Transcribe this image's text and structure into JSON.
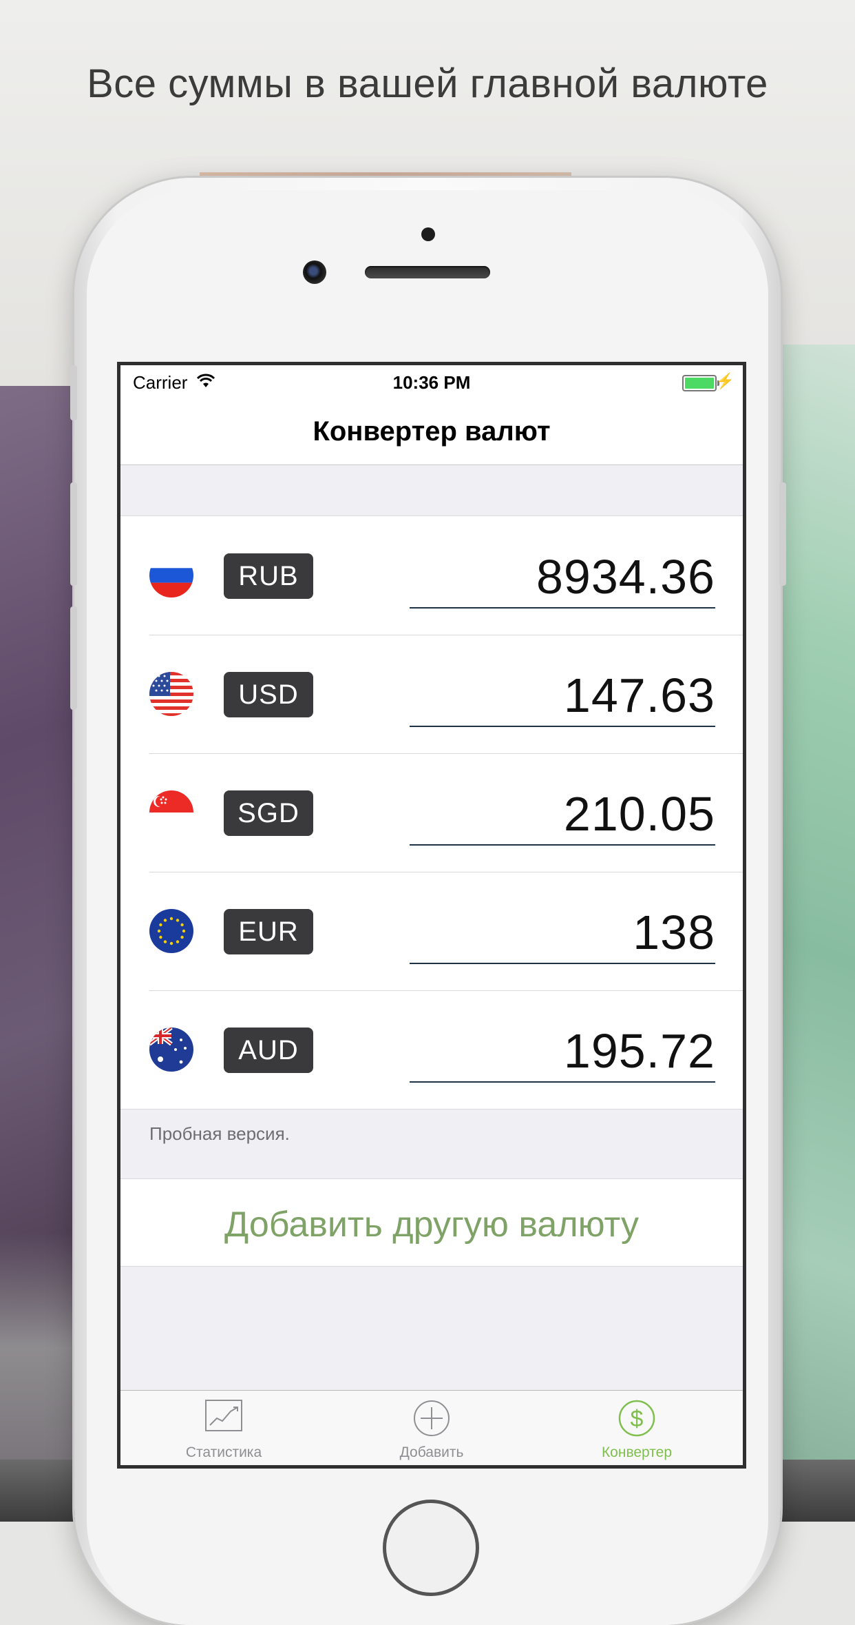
{
  "headline": "Все суммы в вашей главной валюте",
  "status_bar": {
    "carrier": "Carrier",
    "time": "10:36 PM"
  },
  "nav": {
    "title": "Конвертер валют"
  },
  "currencies": [
    {
      "code": "RUB",
      "amount": "8934.36",
      "flag": "russia-flag-icon"
    },
    {
      "code": "USD",
      "amount": "147.63",
      "flag": "usa-flag-icon"
    },
    {
      "code": "SGD",
      "amount": "210.05",
      "flag": "singapore-flag-icon"
    },
    {
      "code": "EUR",
      "amount": "138",
      "flag": "eu-flag-icon"
    },
    {
      "code": "AUD",
      "amount": "195.72",
      "flag": "australia-flag-icon"
    }
  ],
  "trial_note": "Пробная версия.",
  "add_currency_label": "Добавить другую валюту",
  "tabs": [
    {
      "label": "Статистика",
      "icon": "chart-icon",
      "active": false
    },
    {
      "label": "Добавить",
      "icon": "plus-circle-icon",
      "active": false
    },
    {
      "label": "Конвертер",
      "icon": "dollar-circle-icon",
      "active": true
    }
  ],
  "colors": {
    "accent_green": "#7fbf4d",
    "add_text_green": "#7fa267",
    "code_badge": "#3a3a3c"
  }
}
